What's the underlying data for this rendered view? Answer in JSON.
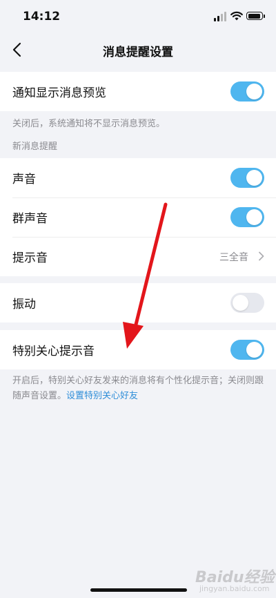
{
  "status_bar": {
    "time": "14:12"
  },
  "nav": {
    "title": "消息提醒设置"
  },
  "preview": {
    "label": "通知显示消息预览",
    "on": true,
    "note": "关闭后，系统通知将不显示消息预览。"
  },
  "section_new": {
    "header": "新消息提醒",
    "sound": {
      "label": "声音",
      "on": true
    },
    "group_sound": {
      "label": "群声音",
      "on": true
    },
    "tone": {
      "label": "提示音",
      "value": "三全音"
    }
  },
  "vibrate": {
    "label": "振动",
    "on": false
  },
  "special": {
    "label": "特别关心提示音",
    "on": true,
    "note_text": "开启后，特别关心好友发来的消息将有个性化提示音；关闭则跟随声音设置。",
    "note_link": "设置特别关心好友"
  },
  "watermark": {
    "brand": "Baidu经验",
    "sub": "jingyan.baidu.com"
  },
  "colors": {
    "toggle_on": "#4fb6ef",
    "toggle_off": "#e6e8ee",
    "link": "#2f8ed8",
    "annotation_arrow": "#e3161b"
  }
}
